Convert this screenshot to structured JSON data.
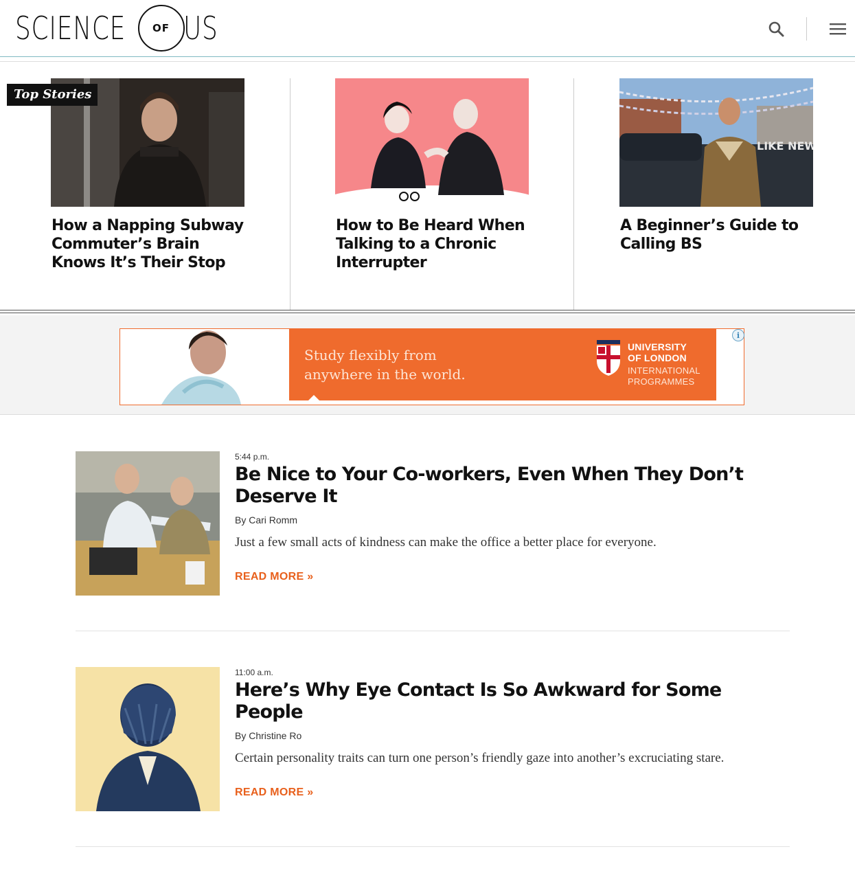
{
  "header": {
    "logo_left": "SCIENCE",
    "logo_mid": "OF",
    "logo_right": "US",
    "icons": [
      "search-icon",
      "menu-icon"
    ]
  },
  "top_stories": {
    "badge": "Top Stories",
    "items": [
      {
        "title": "How a Napping Subway Commuter’s Brain Knows It’s Their Stop"
      },
      {
        "title": "How to Be Heard When Talking to a Chronic Interrupter"
      },
      {
        "title": "A Beginner’s Guide to Calling BS"
      }
    ]
  },
  "ad": {
    "text_line1": "Study flexibly from",
    "text_line2": "anywhere in the world.",
    "uni_line1": "UNIVERSITY",
    "uni_line2": "OF LONDON",
    "uni_line3": "INTERNATIONAL",
    "uni_line4": "PROGRAMMES",
    "info_glyph": "i",
    "car_text": "LIKE NEW",
    "brand_color": "#ef6b2d"
  },
  "articles": [
    {
      "time": "5:44 p.m.",
      "title_line1": "Be Nice to Your Co-workers, Even When They Don’t",
      "title_line2": "Deserve It",
      "author": "By Cari Romm",
      "dek": "Just a few small acts of kindness can make the office a better place for everyone.",
      "more": "READ MORE »"
    },
    {
      "time": "11:00 a.m.",
      "title_line1": "Here’s Why Eye Contact Is So Awkward for Some People",
      "title_line2": "",
      "author": "By Christine Ro",
      "dek": "Certain personality traits can turn one person’s friendly gaze into another’s excruciating stare.",
      "more": "READ MORE »"
    }
  ],
  "colors": {
    "accent": "#e8601c",
    "rule": "#7fb9c2"
  }
}
